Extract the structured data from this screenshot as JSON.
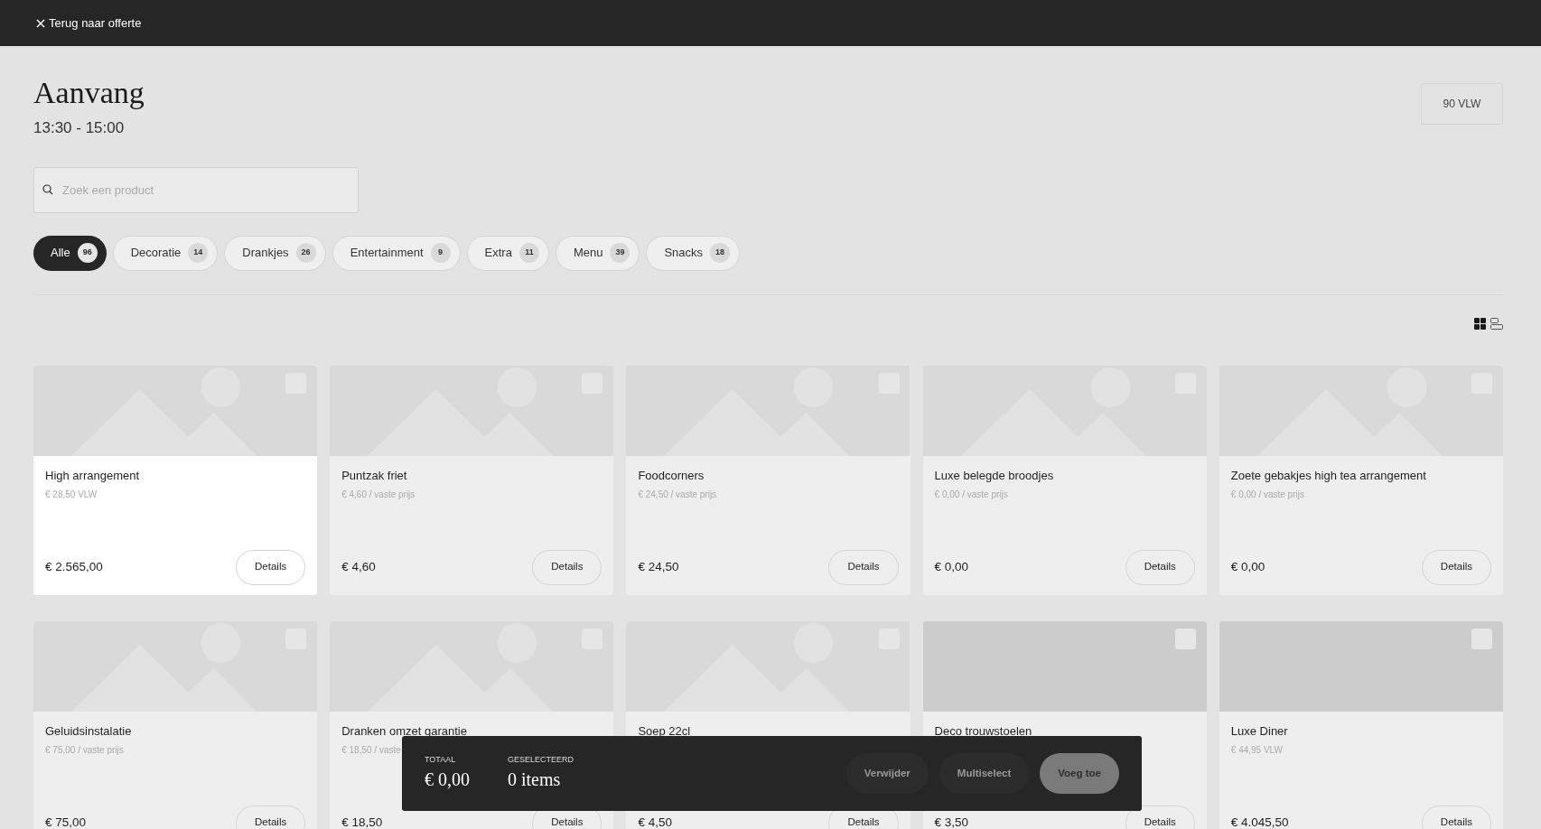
{
  "top_bar": {
    "close_label": "Terug naar offerte"
  },
  "header": {
    "title": "Aanvang",
    "time": "13:30 - 15:00",
    "guests": "90 VLW"
  },
  "search": {
    "placeholder": "Zoek een product"
  },
  "categories": [
    {
      "label": "Alle",
      "count": "96",
      "selected": true
    },
    {
      "label": "Decoratie",
      "count": "14",
      "selected": false
    },
    {
      "label": "Drankjes",
      "count": "26",
      "selected": false
    },
    {
      "label": "Entertainment",
      "count": "9",
      "selected": false
    },
    {
      "label": "Extra",
      "count": "11",
      "selected": false
    },
    {
      "label": "Menu",
      "count": "39",
      "selected": false
    },
    {
      "label": "Snacks",
      "count": "18",
      "selected": false
    }
  ],
  "view_options": [
    {
      "kind": "grid",
      "selected": true
    },
    {
      "kind": "list",
      "selected": false
    }
  ],
  "products": [
    {
      "name": "High arrangement",
      "subtitle": "€ 28,50 VLW",
      "price": "€ 2.565,00",
      "button": "Details",
      "kind": "placeholder",
      "highlighted": true,
      "checked": false
    },
    {
      "name": "Puntzak friet",
      "subtitle": "€ 4,60 / vaste prijs",
      "price": "€ 4,60",
      "button": "Details",
      "kind": "placeholder",
      "highlighted": false,
      "checked": false
    },
    {
      "name": "Foodcorners",
      "subtitle": "€ 24,50 / vaste prijs",
      "price": "€ 24,50",
      "button": "Details",
      "kind": "placeholder",
      "highlighted": false,
      "checked": false
    },
    {
      "name": "Luxe belegde broodjes",
      "subtitle": "€ 0,00 / vaste prijs",
      "price": "€ 0,00",
      "button": "Details",
      "kind": "placeholder",
      "highlighted": false,
      "checked": false
    },
    {
      "name": "Zoete gebakjes high tea arrangement",
      "subtitle": "€ 0,00 / vaste prijs",
      "price": "€ 0,00",
      "button": "Details",
      "kind": "placeholder",
      "highlighted": false,
      "checked": false
    },
    {
      "name": "Geluidsinstalatie",
      "subtitle": "€ 75,00 / vaste prijs",
      "price": "€ 75,00",
      "button": "Details",
      "kind": "placeholder",
      "highlighted": false,
      "checked": false
    },
    {
      "name": "Dranken omzet garantie",
      "subtitle": "€ 18,50 / vaste",
      "price": "€ 18,50",
      "button": "Details",
      "kind": "placeholder",
      "highlighted": false,
      "checked": false
    },
    {
      "name": "Soep 22cl",
      "price": "€ 4,50",
      "button": "Details",
      "kind": "placeholder",
      "highlighted": false,
      "checked": false
    },
    {
      "name": "Deco trouwstoelen",
      "price": "€ 3,50",
      "button": "Details",
      "kind": "blank",
      "highlighted": false,
      "checked": false
    },
    {
      "name": "Luxe Diner",
      "subtitle": "€ 44,95 VLW",
      "price": "€ 4.045,50",
      "button": "Details",
      "kind": "blank",
      "highlighted": false,
      "checked": false
    }
  ],
  "selection_bar": {
    "total_label": "TOTAAL",
    "total": "€ 0,00",
    "selected_label": "GESELECTEERD",
    "selected": "0 items",
    "actions": [
      {
        "label": "Verwijder",
        "kind": "secondary",
        "disabled": false
      },
      {
        "label": "Multiselect",
        "kind": "secondary",
        "disabled": false
      },
      {
        "label": "Voeg toe",
        "kind": "primary",
        "disabled": true
      }
    ]
  }
}
